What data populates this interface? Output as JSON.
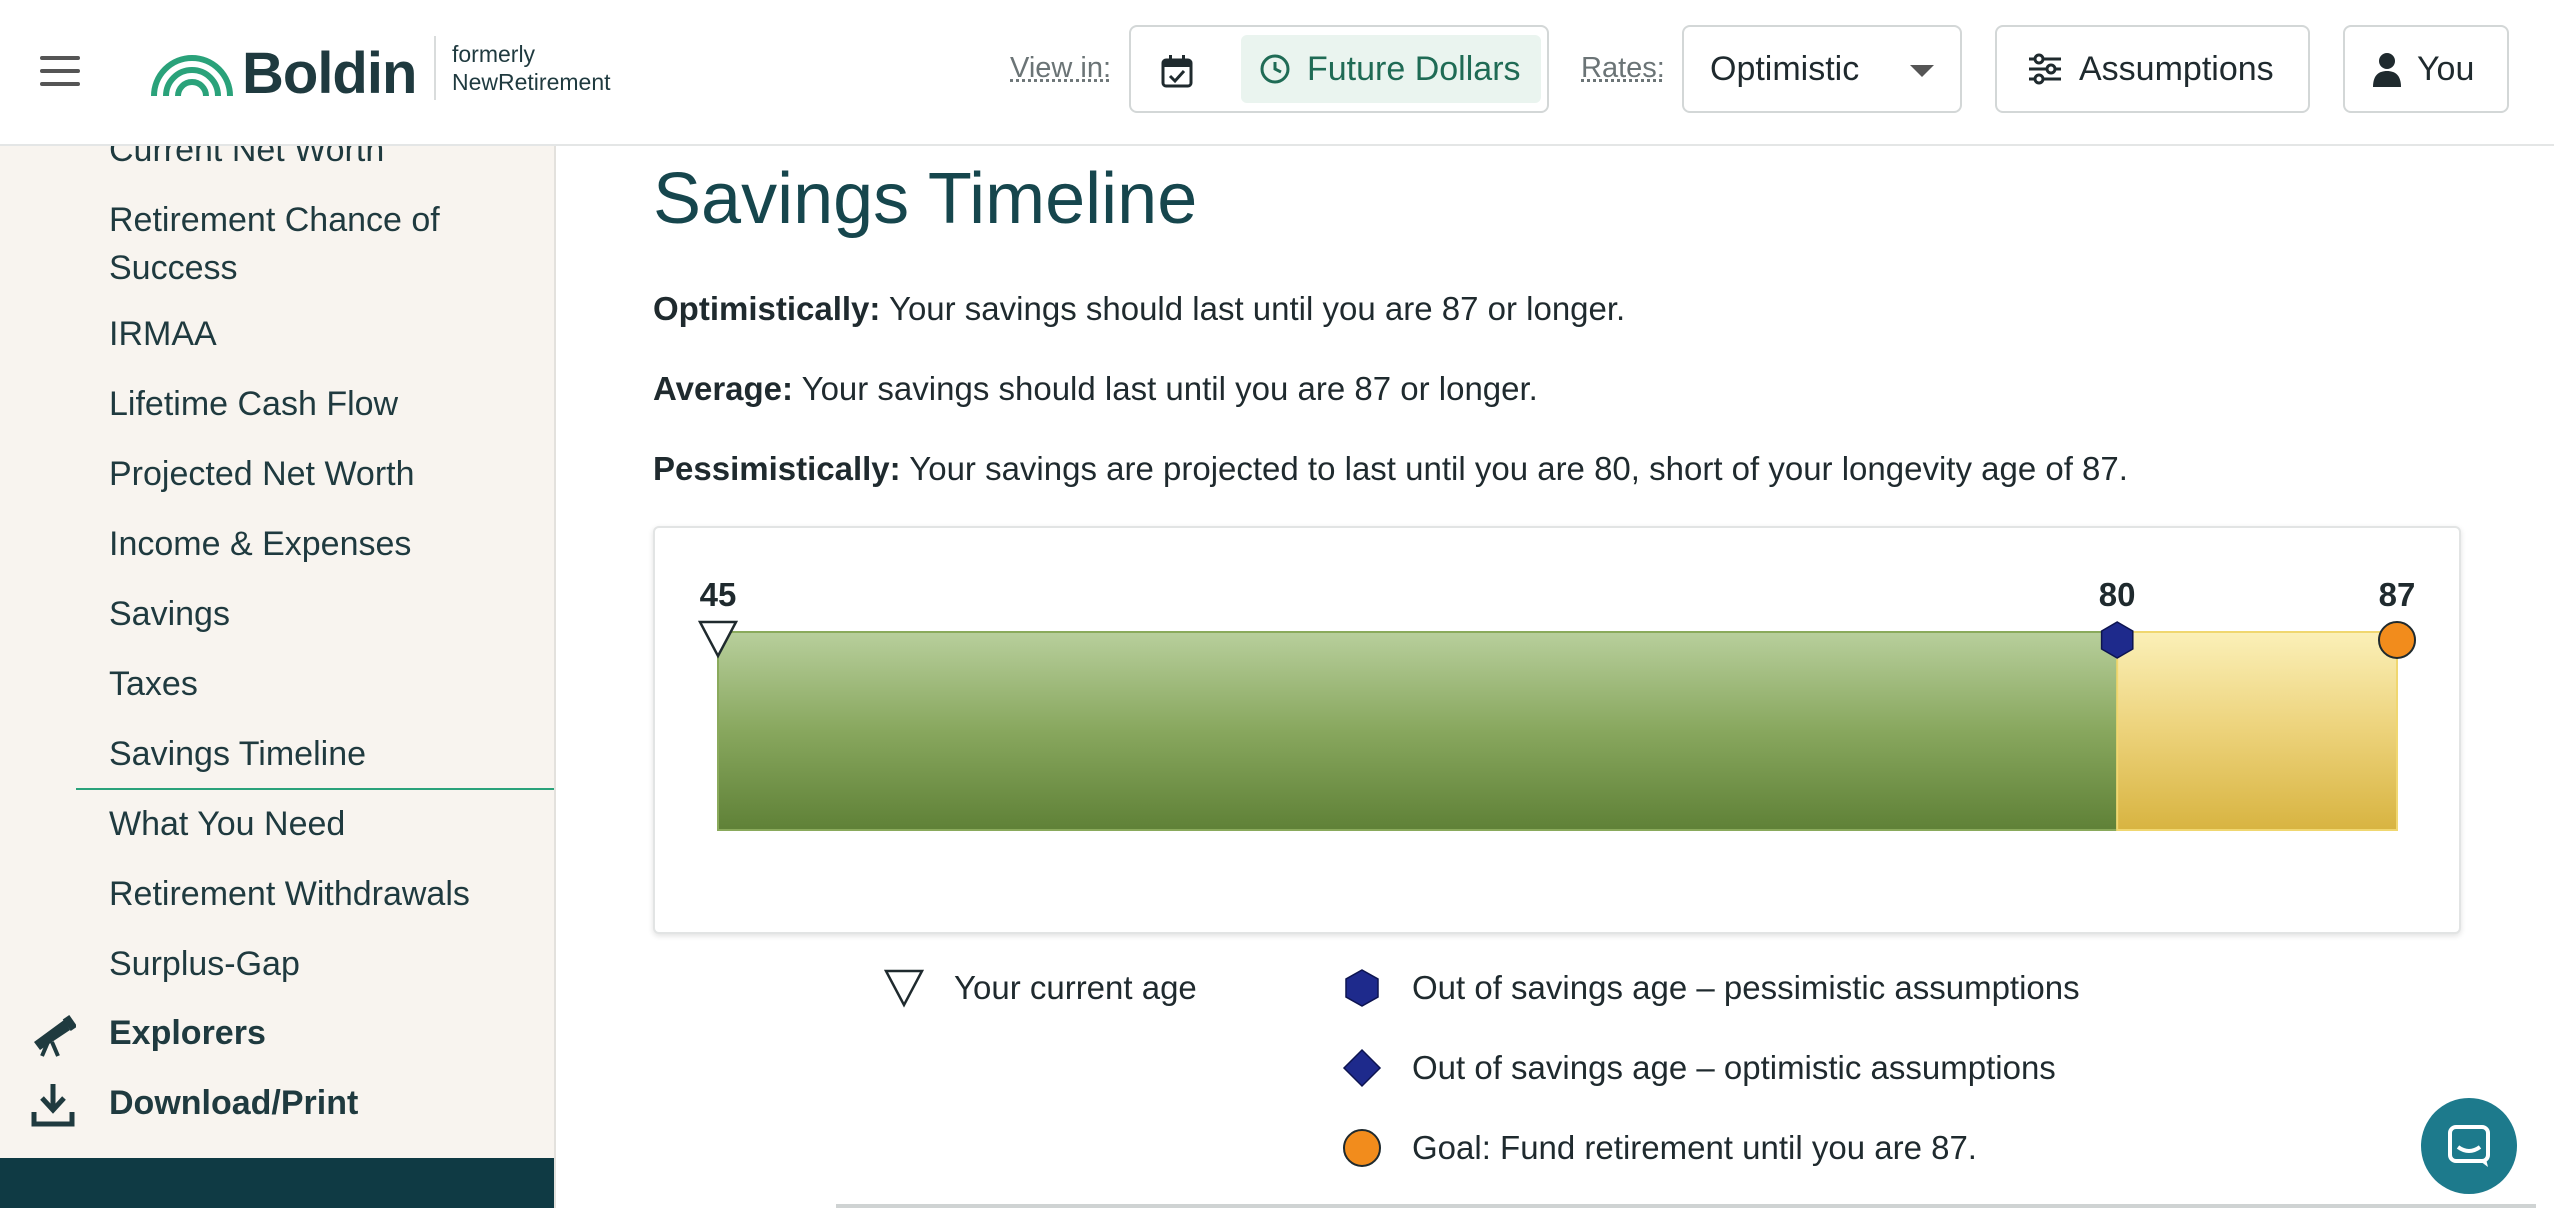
{
  "header": {
    "logo_text": "Boldin",
    "formerly_line1": "formerly",
    "formerly_line2": "NewRetirement",
    "view_in_label": "View in:",
    "future_dollars_label": "Future Dollars",
    "rates_label": "Rates:",
    "rates_value": "Optimistic",
    "assumptions_label": "Assumptions",
    "user_label": "You"
  },
  "sidebar": {
    "items": [
      "Current Net Worth",
      "Retirement Chance of",
      "Success",
      "IRMAA",
      "Lifetime Cash Flow",
      "Projected Net Worth",
      "Income & Expenses",
      "Savings",
      "Taxes",
      "Savings Timeline",
      "What You Need",
      "Retirement Withdrawals",
      "Surplus-Gap"
    ],
    "active_item": "Savings Timeline",
    "explorers_label": "Explorers",
    "download_label": "Download/Print"
  },
  "main": {
    "title": "Savings Timeline",
    "optimistic_label": "Optimistically:",
    "optimistic_text": " Your savings should last until you are 87 or longer.",
    "average_label": "Average:",
    "average_text": " Your savings should last until you are 87 or longer.",
    "pessimistic_label": "Pessimistically:",
    "pessimistic_text": " Your savings are projected to last until you are 80, short of your longevity age of 87."
  },
  "chart_data": {
    "type": "bar",
    "current_age": 45,
    "out_of_savings_pessimistic": 80,
    "goal_age": 87,
    "range": [
      45,
      87
    ],
    "marker_labels": [
      "45",
      "80",
      "87"
    ],
    "segments": [
      {
        "from": 45,
        "to": 80,
        "color": "#6f9245"
      },
      {
        "from": 80,
        "to": 87,
        "color": "#e4c457"
      }
    ],
    "colors": {
      "current_marker": "#ffffff",
      "pessimistic_marker": "#1e2a8c",
      "optimistic_marker": "#1e2a8c",
      "goal_marker": "#f28c1c"
    }
  },
  "legend": {
    "current_age": "Your current age",
    "pessimistic": "Out of savings age – pessimistic assumptions",
    "optimistic": "Out of savings age – optimistic assumptions",
    "goal": "Goal: Fund retirement until you are 87."
  }
}
